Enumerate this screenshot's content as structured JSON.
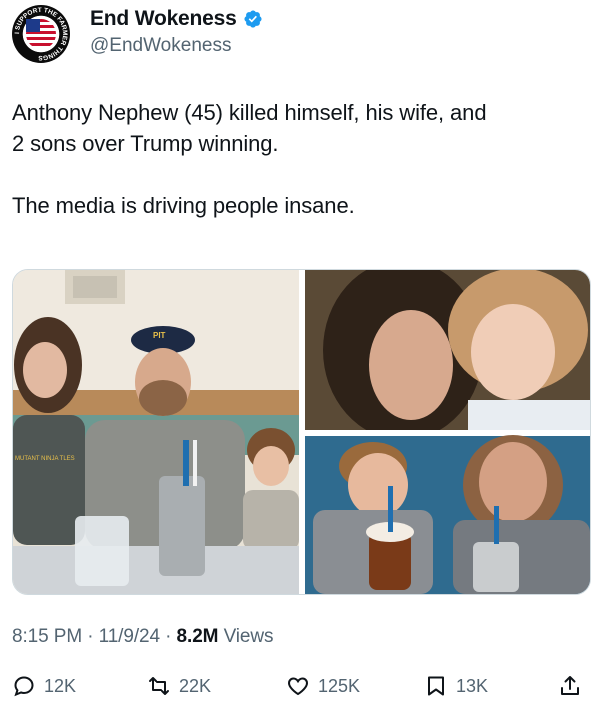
{
  "author": {
    "name": "End Wokeness",
    "handle": "@EndWokeness",
    "avatar_label": "I SUPPORT THE FARMER THINGS",
    "avatar_icon": "flag-avatar-icon",
    "verified_icon": "verified-badge-icon"
  },
  "tweet": {
    "text": "Anthony Nephew (45) killed himself, his wife, and\n2 sons over Trump winning.\n\nThe media is driving people insane.",
    "time": "8:15 PM",
    "date": "11/9/24",
    "views_count": "8.2M",
    "views_label": "Views",
    "separator": " · "
  },
  "media": {
    "shirt_text": "MUTANT NINJA TLES",
    "cap_text": "PIT"
  },
  "actions": {
    "replies": "12K",
    "retweets": "22K",
    "likes": "125K",
    "bookmarks": "13K"
  },
  "colors": {
    "text": "#0f1419",
    "secondary": "#536471",
    "verified": "#1d9bf0",
    "border": "#cfd9de"
  }
}
